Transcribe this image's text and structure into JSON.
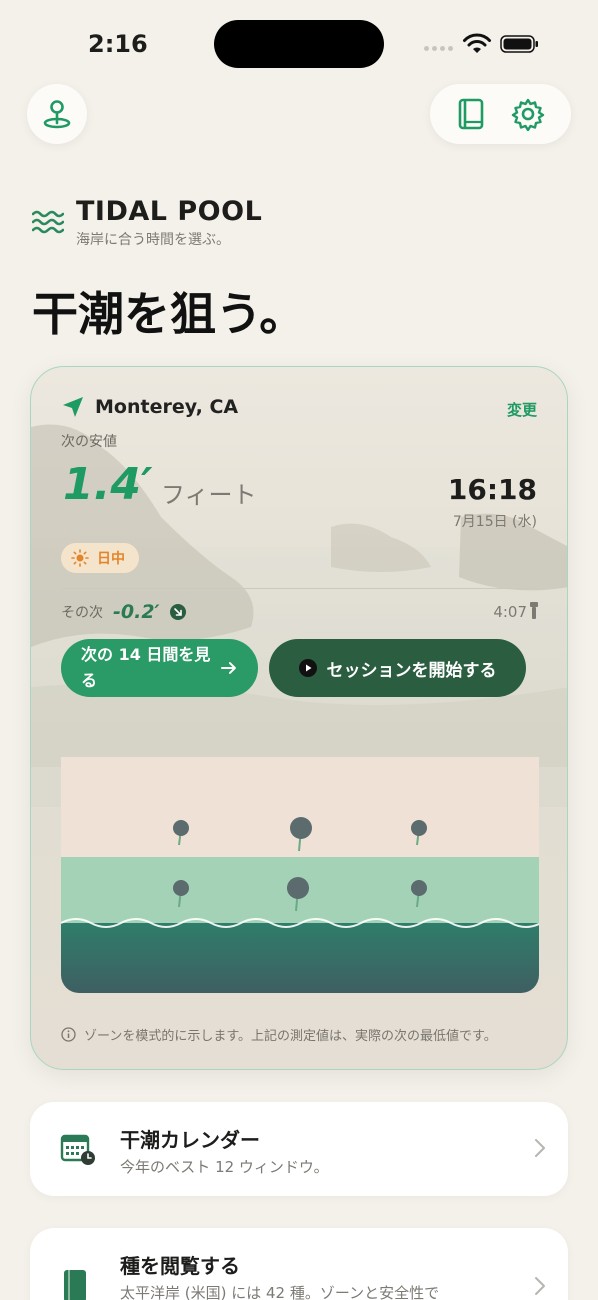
{
  "status_bar": {
    "time": "2:16"
  },
  "brand": {
    "title": "TIDAL POOL",
    "subtitle": "海岸に合う時間を選ぶ。"
  },
  "headline": "干潮を狙う。",
  "tide_card": {
    "location": "Monterey, CA",
    "change_label": "変更",
    "next_low_label": "次の安値",
    "value": "1.4′",
    "unit": "フィート",
    "time": "16:18",
    "date": "7月15日 (水)",
    "daylight_badge": "日中",
    "then_label": "その次",
    "then_value": "-0.2′",
    "then_time": "4:07",
    "view_days_button": "次の 14 日間を見る",
    "start_session_button": "セッションを開始する",
    "zone_note": "ゾーンを模式的に示します。上記の測定値は、実際の次の最低値です。"
  },
  "list_items": [
    {
      "title": "干潮カレンダー",
      "subtitle": "今年のベスト 12 ウィンドウ。"
    },
    {
      "title": "種を閲覧する",
      "subtitle": "太平洋岸 (米国) には 42 種。ゾーンと安全性で"
    }
  ],
  "colors": {
    "accent": "#1e9a63",
    "dark_green": "#2b5e40",
    "daylight": "#e3862b"
  }
}
